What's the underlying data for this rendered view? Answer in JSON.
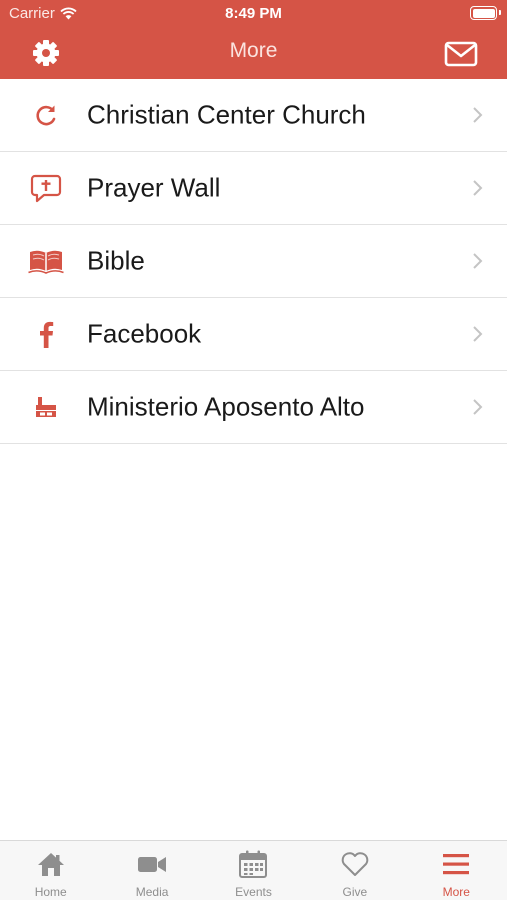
{
  "status_bar": {
    "carrier": "Carrier",
    "time": "8:49 PM"
  },
  "nav": {
    "title": "More",
    "left_icon": "gear-icon",
    "right_icon": "mail-icon"
  },
  "accent_color": "#d55446",
  "items": [
    {
      "label": "Christian Center Church",
      "icon": "refresh-arrow-icon"
    },
    {
      "label": "Prayer Wall",
      "icon": "chat-cross-icon"
    },
    {
      "label": "Bible",
      "icon": "open-book-icon"
    },
    {
      "label": "Facebook",
      "icon": "facebook-icon"
    },
    {
      "label": "Ministerio Aposento Alto",
      "icon": "upper-room-icon"
    }
  ],
  "tabs": [
    {
      "label": "Home",
      "icon": "home-icon",
      "active": false
    },
    {
      "label": "Media",
      "icon": "video-camera-icon",
      "active": false
    },
    {
      "label": "Events",
      "icon": "calendar-icon",
      "active": false
    },
    {
      "label": "Give",
      "icon": "heart-icon",
      "active": false
    },
    {
      "label": "More",
      "icon": "menu-icon",
      "active": true
    }
  ]
}
